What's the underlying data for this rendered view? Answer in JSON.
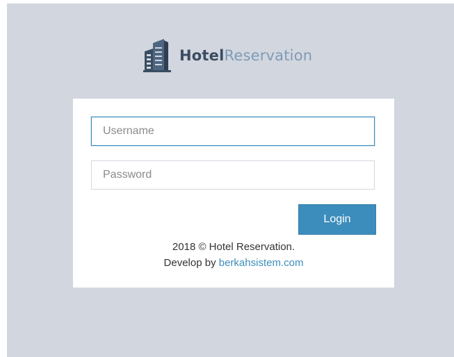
{
  "brand": {
    "name_strong": "Hotel",
    "name_light": "Reservation",
    "icon": "hotel-building-icon"
  },
  "form": {
    "username_placeholder": "Username",
    "password_placeholder": "Password",
    "login_label": "Login"
  },
  "footer": {
    "copyright": "2018 © Hotel Reservation.",
    "develop_prefix": "Develop by ",
    "developer_link": "berkahsistem.com"
  },
  "colors": {
    "background": "#d2d6de",
    "accent": "#3c8dbc",
    "brand_dark": "#3a4c61",
    "brand_light": "#7f9bb7"
  }
}
